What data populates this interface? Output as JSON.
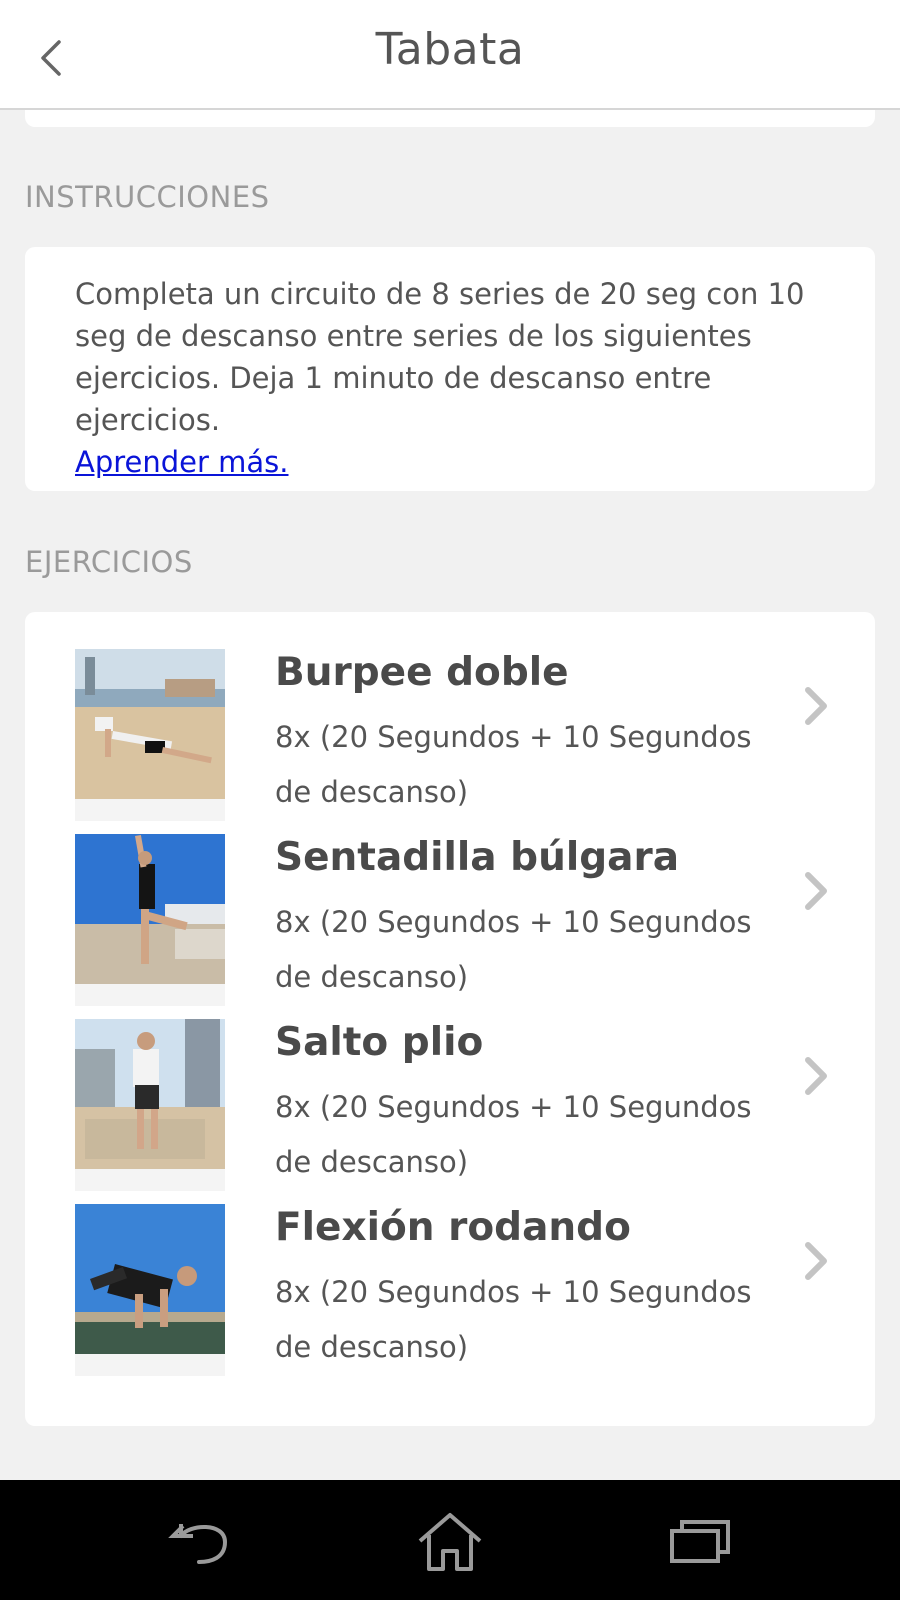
{
  "header": {
    "title": "Tabata",
    "back_icon": "chevron-left-icon"
  },
  "instructions": {
    "section_label": "INSTRUCCIONES",
    "text": "Completa un circuito de 8 series de 20 seg con 10 seg de descanso entre series de los siguientes ejercicios. Deja 1 minuto de descanso entre ejercicios.",
    "link_label": "Aprender más."
  },
  "exercises": {
    "section_label": "EJERCICIOS",
    "items": [
      {
        "name": "Burpee doble",
        "detail": "8x (20 Segundos + 10 Segundos de descanso)",
        "thumb": "burpee-photo"
      },
      {
        "name": "Sentadilla búlgara",
        "detail": "8x (20 Segundos + 10 Segundos de descanso)",
        "thumb": "bulgarian-squat-photo"
      },
      {
        "name": "Salto plio",
        "detail": "8x (20 Segundos + 10 Segundos de descanso)",
        "thumb": "plyo-jump-photo"
      },
      {
        "name": "Flexión rodando",
        "detail": "8x (20 Segundos + 10 Segundos de descanso)",
        "thumb": "rolling-pushup-photo"
      }
    ]
  },
  "system_nav": {
    "back_icon": "system-back-icon",
    "home_icon": "system-home-icon",
    "recents_icon": "system-recents-icon"
  },
  "colors": {
    "background": "#f1f1f1",
    "card": "#ffffff",
    "link": "#0a14d8",
    "section_label": "#9a9a9a",
    "nav_bar": "#000000"
  }
}
